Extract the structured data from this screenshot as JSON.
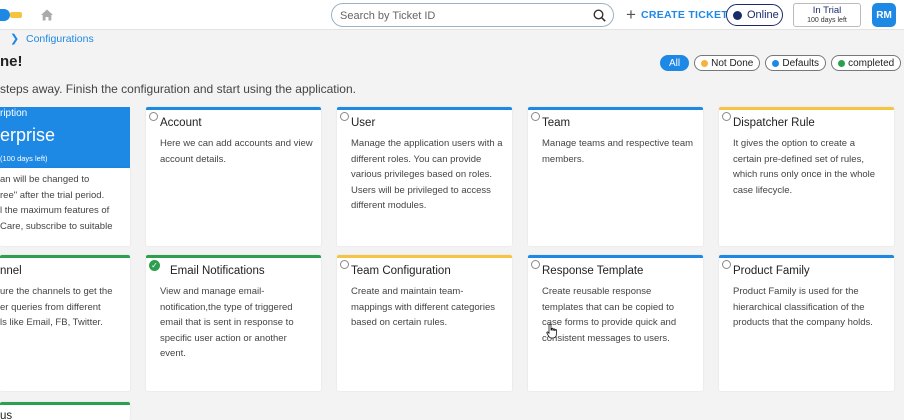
{
  "header": {
    "search_placeholder": "Search by Ticket ID",
    "create_ticket": "CREATE TICKET",
    "status": "Online",
    "trial_title": "In Trial",
    "trial_days": "100 days left",
    "avatar_initials": "RM"
  },
  "breadcrumb": {
    "current": "Configurations"
  },
  "page": {
    "greeting": "ne!",
    "subtitle": "steps away. Finish the configuration and start using the application."
  },
  "filters": {
    "all": "All",
    "not_done": "Not Done",
    "defaults": "Defaults",
    "completed": "completed",
    "colors": {
      "not_done": "#f5b33d",
      "defaults": "#1e88e5",
      "completed": "#2e9f4e"
    }
  },
  "subscription": {
    "label": "ription",
    "plan": "erprise",
    "days_left": "(100 days left)",
    "desc": "an will be changed to\nree\" after the trial period.\nl the maximum features of\nCare, subscribe to suitable"
  },
  "cards": {
    "account": {
      "title": "Account",
      "desc": "Here we can add accounts and view account details."
    },
    "user": {
      "title": "User",
      "desc": "Manage the application users with a different roles. You can provide various privileges based on roles. Users will be privileged to access different modules."
    },
    "team": {
      "title": "Team",
      "desc": "Manage teams and respective team members."
    },
    "dispatcher_rule": {
      "title": "Dispatcher Rule",
      "desc": "It gives the option to create a certain pre-defined set of rules, which runs only once in the whole case lifecycle."
    },
    "channel": {
      "title": "nnel",
      "desc": "ure the channels to get the\ner queries from different\nls like Email, FB, Twitter."
    },
    "email_notifications": {
      "title": "Email Notifications",
      "desc": "View and manage email-notification,the type of triggered email that is sent in response to specific user action or another event."
    },
    "team_configuration": {
      "title": "Team Configuration",
      "desc": "Create and maintain team-mappings with different categories based on certain rules."
    },
    "response_template": {
      "title": "Response Template",
      "desc": "Create reusable response templates that can be copied to case forms to provide quick and consistent messages to users."
    },
    "product_family": {
      "title": "Product Family",
      "desc": "Product Family is used for the hierarchical classification of the products that the company holds."
    },
    "status_partial": {
      "title": "us"
    }
  },
  "colors": {
    "accent": "#1e88e5",
    "yellow": "#f5c542",
    "green": "#2e9f4e",
    "navy": "#1a2b6b"
  }
}
